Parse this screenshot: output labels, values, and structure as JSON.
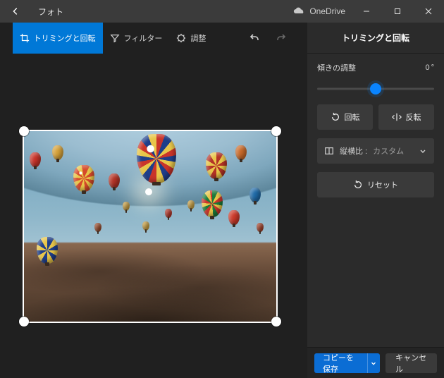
{
  "titlebar": {
    "app_name": "フォト",
    "onedrive_label": "OneDrive"
  },
  "toolbar": {
    "crop_rotate": "トリミングと回転",
    "filters": "フィルター",
    "adjust": "調整"
  },
  "panel": {
    "title": "トリミングと回転",
    "straighten_label": "傾きの調整",
    "straighten_value": "0",
    "straighten_unit": "°",
    "slider_pct": 50,
    "rotate_label": "回転",
    "flip_label": "反転",
    "aspect_label": "縦横比 :",
    "aspect_value": "カスタム",
    "reset_label": "リセット"
  },
  "footer": {
    "save_copy": "コピーを保存",
    "cancel": "キャンセル"
  },
  "colors": {
    "accent": "#0078d7"
  }
}
